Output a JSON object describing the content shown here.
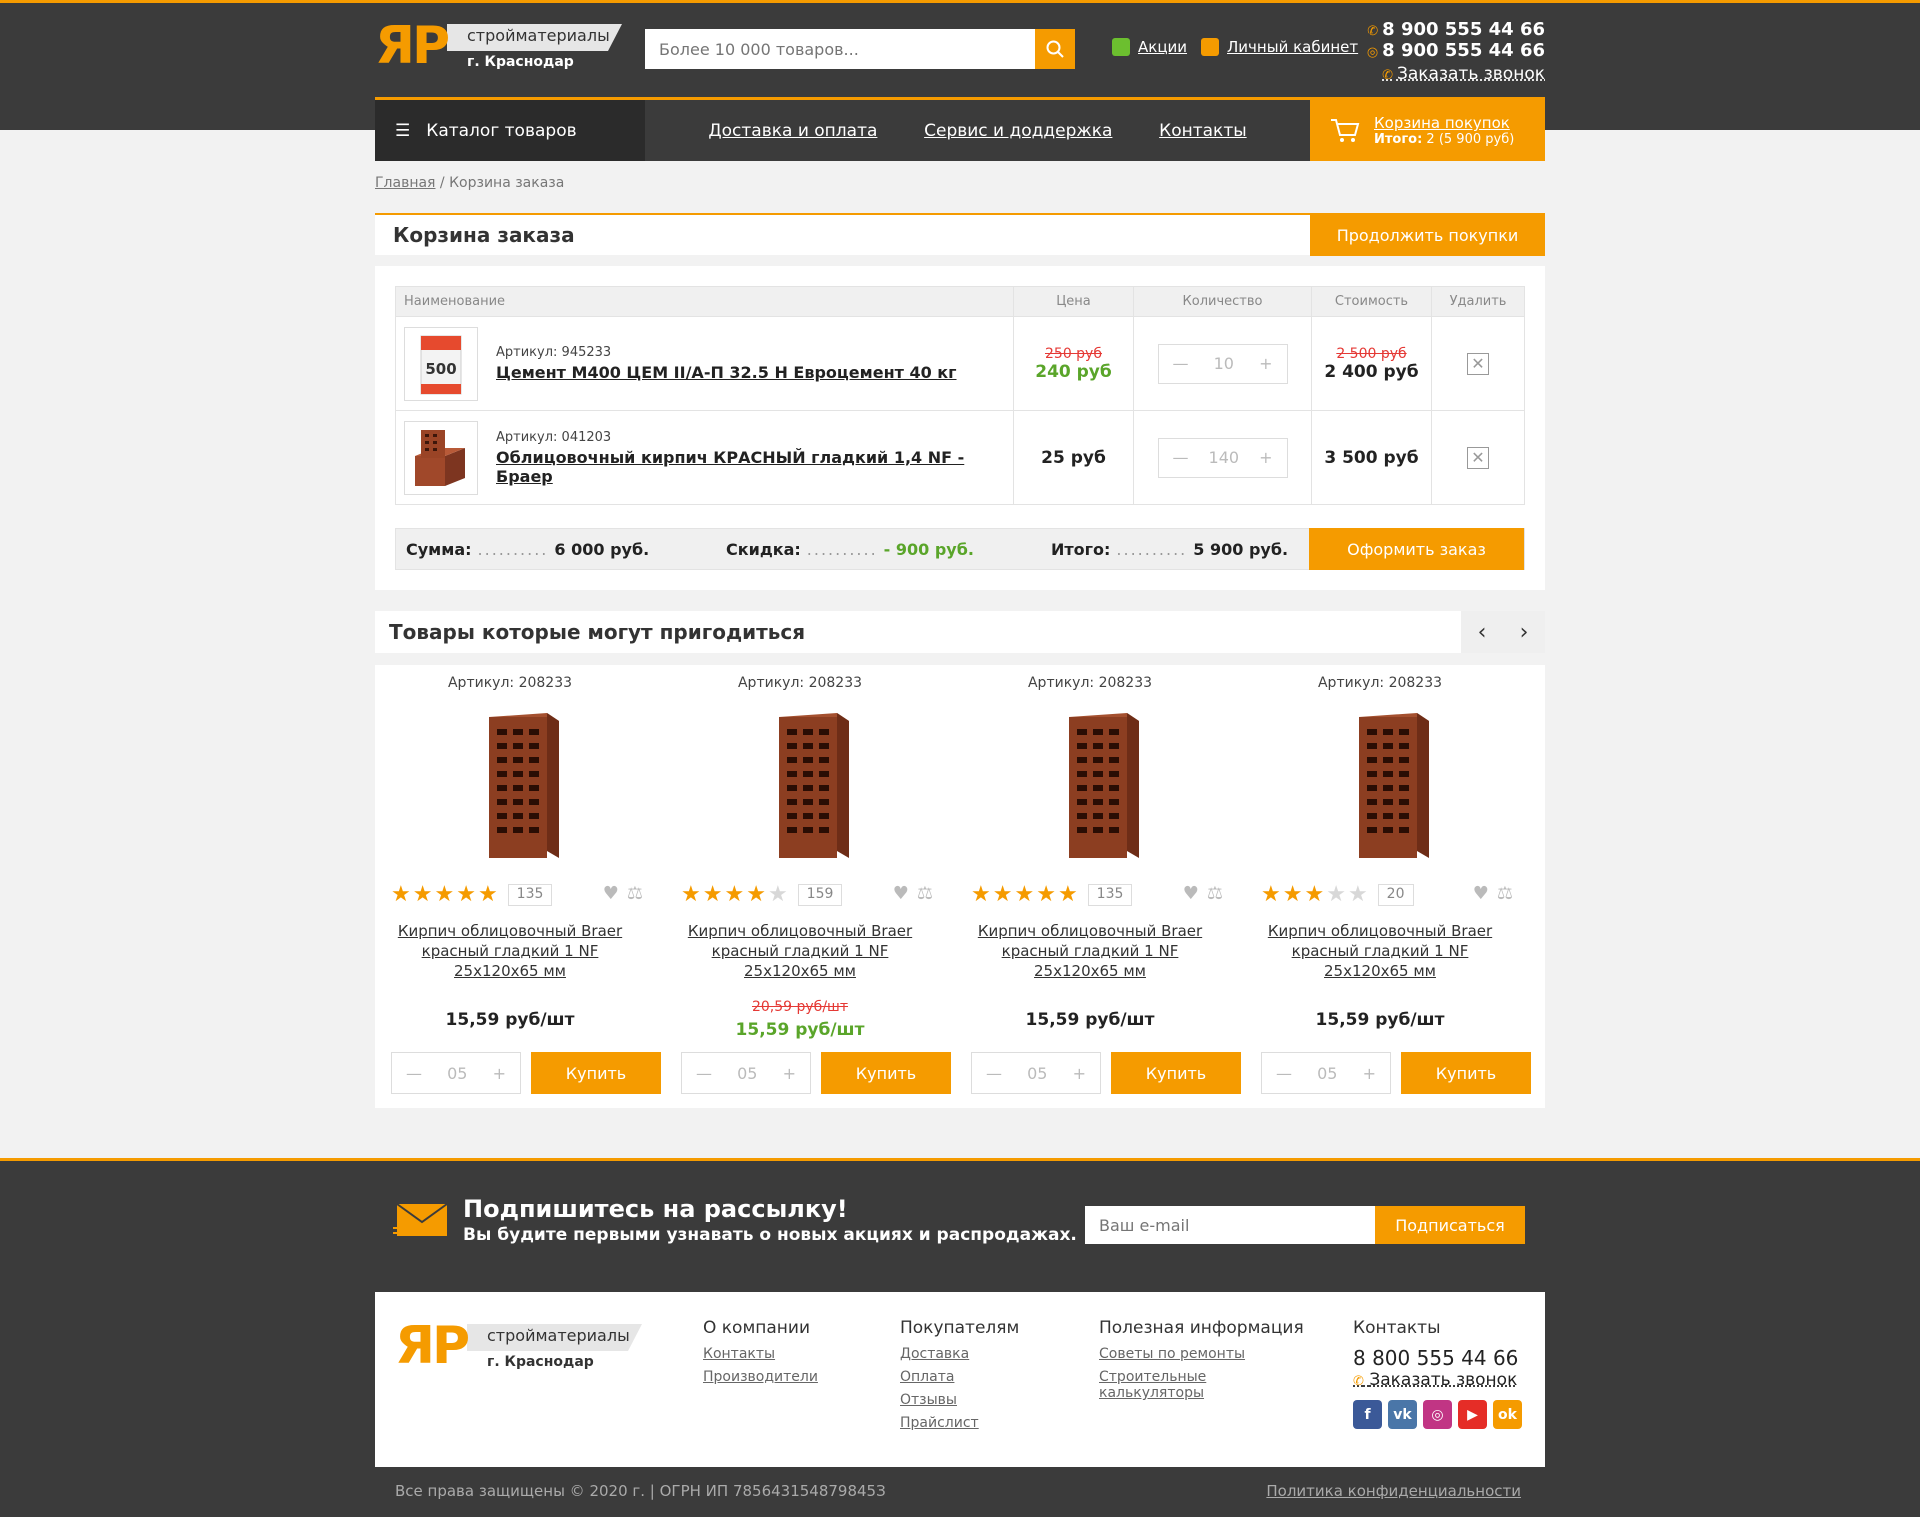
{
  "header": {
    "logo_mark": "ЯР",
    "logo_line1": "стройматериалы",
    "logo_line2": "г. Краснодар",
    "search_placeholder": "Более 10 000 товаров...",
    "promo_link": "Акции",
    "account_link": "Личный кабинет",
    "phone1": "8 900 555 44 66",
    "phone2": "8 900 555 44 66",
    "callback": "Заказать звонок"
  },
  "nav": {
    "catalog": "Каталог товаров",
    "links": [
      "Доставка и оплата",
      "Сервис и доддержка",
      "Контакты"
    ],
    "cart_title": "Корзина покупок",
    "cart_total_label": "Итого:",
    "cart_total_value": "2 (5 900 руб)"
  },
  "breadcrumb": {
    "home": "Главная",
    "current": "Корзина заказа"
  },
  "cart": {
    "title": "Корзина заказа",
    "continue_button": "Продолжить покупки",
    "columns": [
      "Наименование",
      "Цена",
      "Количество",
      "Стоимость",
      "Удалить"
    ],
    "items": [
      {
        "article_label": "Артикул:",
        "article": "945233",
        "name": "Цемент М400 ЦЕМ II/А-П 32.5 Н Евроцемент 40 кг",
        "old_price": "250 руб",
        "price": "240 руб",
        "qty": "10",
        "old_cost": "2 500 руб",
        "cost": "2 400 руб"
      },
      {
        "article_label": "Артикул:",
        "article": "041203",
        "name": "Облицовочный кирпич КРАСНЫЙ гладкий 1,4 NF - Браер",
        "price": "25 руб",
        "qty": "140",
        "cost": "3 500 руб"
      }
    ],
    "sum_label": "Сумма:",
    "sum_dots": "..........",
    "sum_value": "6 000 руб.",
    "discount_label": "Скидка:",
    "discount_dots": "..........",
    "discount_value": "- 900 руб.",
    "total_label": "Итого:",
    "total_dots": "..........",
    "total_value": "5 900 руб.",
    "checkout_button": "Оформить заказ"
  },
  "recommended": {
    "title": "Товары которые могут пригодиться",
    "products": [
      {
        "article_label": "Артикул:",
        "article": "208233",
        "rating": 5,
        "reviews": "135",
        "name": "Кирпич облицовочный Braer красный гладкий 1 NF 25х120х65 мм",
        "price": "15,59 руб/шт",
        "qty": "05",
        "buy": "Купить"
      },
      {
        "article_label": "Артикул:",
        "article": "208233",
        "rating": 4,
        "reviews": "159",
        "name": "Кирпич облицовочный Braer красный гладкий 1 NF 25х120х65 мм",
        "old_price": "20,59 руб/шт",
        "price": "15,59 руб/шт",
        "qty": "05",
        "buy": "Купить"
      },
      {
        "article_label": "Артикул:",
        "article": "208233",
        "rating": 5,
        "reviews": "135",
        "name": "Кирпич облицовочный Braer красный гладкий 1 NF 25х120х65 мм",
        "price": "15,59 руб/шт",
        "qty": "05",
        "buy": "Купить"
      },
      {
        "article_label": "Артикул:",
        "article": "208233",
        "rating": 3,
        "reviews": "20",
        "name": "Кирпич облицовочный Braer красный гладкий 1 NF 25х120х65 мм",
        "price": "15,59 руб/шт",
        "qty": "05",
        "buy": "Купить"
      }
    ]
  },
  "subscribe": {
    "title": "Подпишитесь на рассылку!",
    "subtitle": "Вы будите первыми узнавать о новых акциях и распродажах.",
    "placeholder": "Ваш e-mail",
    "button": "Подписаться"
  },
  "footer": {
    "col1": {
      "title": "О компании",
      "links": [
        "Контакты",
        "Производители"
      ]
    },
    "col2": {
      "title": "Покупателям",
      "links": [
        "Доставка",
        "Оплата",
        "Отзывы",
        "Прайслист"
      ]
    },
    "col3": {
      "title": "Полезная информация",
      "links": [
        "Советы по ремонты",
        "Строительные калькуляторы"
      ]
    },
    "contacts": {
      "title": "Контакты",
      "phone": "8 800 555 44 66",
      "callback": "Заказать звонок"
    },
    "copyright": "Все права защищены © 2020 г. | ОГРН ИП 785643154879845З",
    "policy": "Политика конфиденциальности"
  },
  "colors": {
    "accent": "#f59b00",
    "dark": "#3b3b3b",
    "green": "#5aa52a",
    "red": "#e53935"
  }
}
